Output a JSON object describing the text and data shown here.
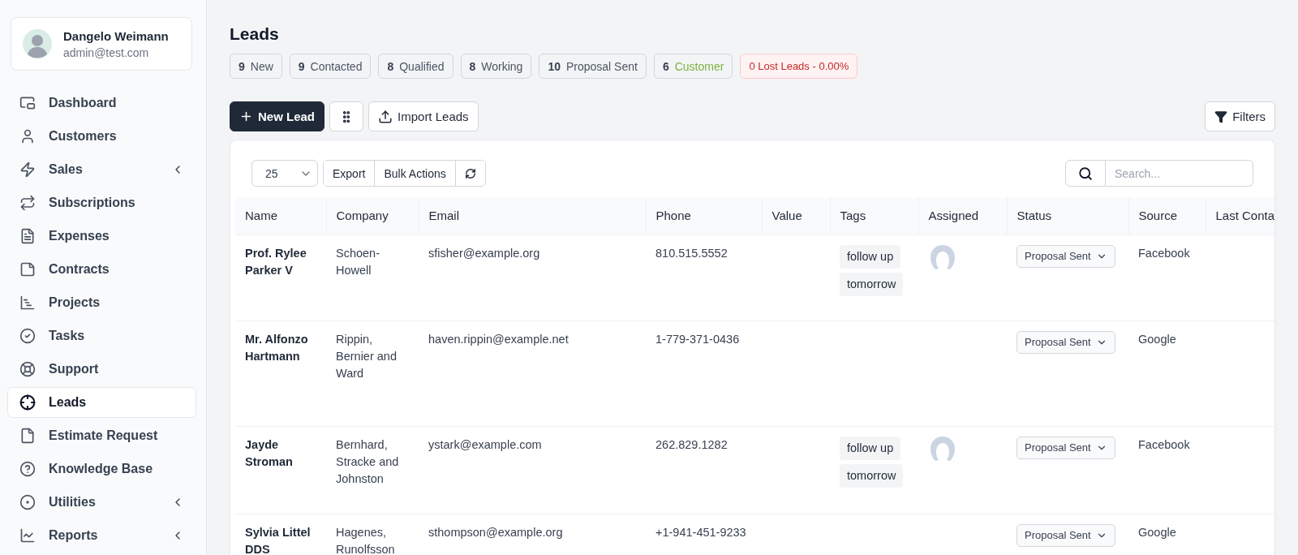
{
  "user": {
    "name": "Dangelo Weimann",
    "email": "admin@test.com"
  },
  "sidebar": {
    "items": [
      {
        "label": "Dashboard",
        "selected": false,
        "has_submenu": false
      },
      {
        "label": "Customers",
        "selected": false,
        "has_submenu": false
      },
      {
        "label": "Sales",
        "selected": false,
        "has_submenu": true
      },
      {
        "label": "Subscriptions",
        "selected": false,
        "has_submenu": false
      },
      {
        "label": "Expenses",
        "selected": false,
        "has_submenu": false
      },
      {
        "label": "Contracts",
        "selected": false,
        "has_submenu": false
      },
      {
        "label": "Projects",
        "selected": false,
        "has_submenu": false
      },
      {
        "label": "Tasks",
        "selected": false,
        "has_submenu": false
      },
      {
        "label": "Support",
        "selected": false,
        "has_submenu": false
      },
      {
        "label": "Leads",
        "selected": true,
        "has_submenu": false
      },
      {
        "label": "Estimate Request",
        "selected": false,
        "has_submenu": false
      },
      {
        "label": "Knowledge Base",
        "selected": false,
        "has_submenu": false
      },
      {
        "label": "Utilities",
        "selected": false,
        "has_submenu": true
      },
      {
        "label": "Reports",
        "selected": false,
        "has_submenu": true
      }
    ]
  },
  "page": {
    "title": "Leads"
  },
  "stats": [
    {
      "kind": "count",
      "count": "9",
      "label": "New",
      "color": "#4b5563"
    },
    {
      "kind": "count",
      "count": "9",
      "label": "Contacted",
      "color": "#4b5563"
    },
    {
      "kind": "count",
      "count": "8",
      "label": "Qualified",
      "color": "#4b5563"
    },
    {
      "kind": "count",
      "count": "8",
      "label": "Working",
      "color": "#4b5563"
    },
    {
      "kind": "count",
      "count": "10",
      "label": "Proposal Sent",
      "color": "#4b5563"
    },
    {
      "kind": "count",
      "count": "6",
      "label": "Customer",
      "color": "#7cb342"
    },
    {
      "kind": "alert",
      "label": "0 Lost Leads - 0.00%",
      "color": "#c62828"
    }
  ],
  "actions": {
    "new_lead": "New Lead",
    "import": "Import Leads",
    "filters": "Filters"
  },
  "table_toolbar": {
    "page_size": "25",
    "buttons": [
      "Export",
      "Bulk Actions"
    ],
    "search_placeholder": "Search..."
  },
  "table": {
    "columns": [
      "Name",
      "Company",
      "Email",
      "Phone",
      "Value",
      "Tags",
      "Assigned",
      "Status",
      "Source",
      "Last Conta"
    ],
    "rows": [
      {
        "name": "Prof. Rylee Parker V",
        "company": "Schoen-Howell",
        "email": "sfisher@example.org",
        "phone": "810.515.5552",
        "tags": [
          "follow up",
          "tomorrow"
        ],
        "assigned": true,
        "status": "Proposal Sent",
        "source": "Facebook"
      },
      {
        "name": "Mr. Alfonzo Hartmann",
        "company": "Rippin, Bernier and Ward",
        "email": "haven.rippin@example.net",
        "phone": "1-779-371-0436",
        "tags": [],
        "assigned": false,
        "status": "Proposal Sent",
        "source": "Google"
      },
      {
        "name": "Jayde Stroman",
        "company": "Bernhard, Stracke and Johnston",
        "email": "ystark@example.com",
        "phone": "262.829.1282",
        "tags": [
          "follow up",
          "tomorrow"
        ],
        "assigned": true,
        "status": "Proposal Sent",
        "source": "Facebook"
      },
      {
        "name": "Sylvia Littel DDS",
        "company": "Hagenes, Runolfsson",
        "email": "sthompson@example.org",
        "phone": "+1-941-451-9233",
        "tags": [],
        "assigned": false,
        "status": "Proposal Sent",
        "source": "Google"
      }
    ]
  }
}
